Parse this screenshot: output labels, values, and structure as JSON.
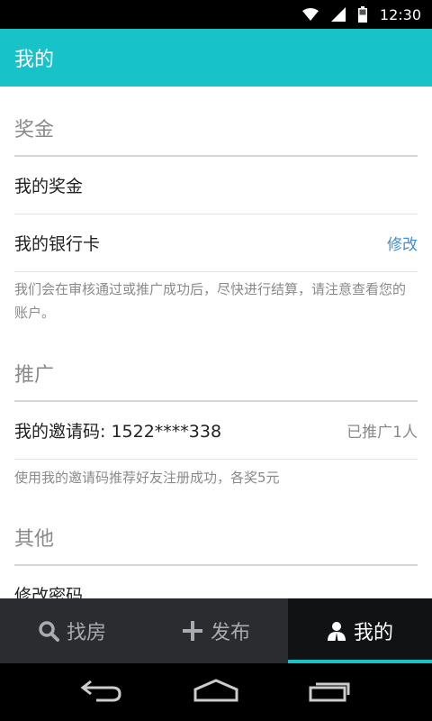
{
  "status_bar": {
    "time": "12:30"
  },
  "app_bar": {
    "title": "我的"
  },
  "sections": {
    "bonus": {
      "header": "奖金",
      "my_bonus": "我的奖金",
      "bank_card": "我的银行卡",
      "bank_card_action": "修改",
      "note": "我们会在审核通过或推广成功后，尽快进行结算，请注意查看您的账户。"
    },
    "promo": {
      "header": "推广",
      "invite_code": "我的邀请码: 1522****338",
      "promoted_count": "已推广1人",
      "note": "使用我的邀请码推荐好友注册成功，各奖5元"
    },
    "other": {
      "header": "其他",
      "change_password": "修改密码"
    }
  },
  "bottom_nav": {
    "items": [
      {
        "label": "找房",
        "icon": "search-icon"
      },
      {
        "label": "发布",
        "icon": "plus-icon"
      },
      {
        "label": "我的",
        "icon": "user-icon",
        "active": true
      }
    ]
  },
  "colors": {
    "primary": "#17c2c9",
    "link": "#3f8fd2",
    "nav_bg": "#2a2c30"
  }
}
